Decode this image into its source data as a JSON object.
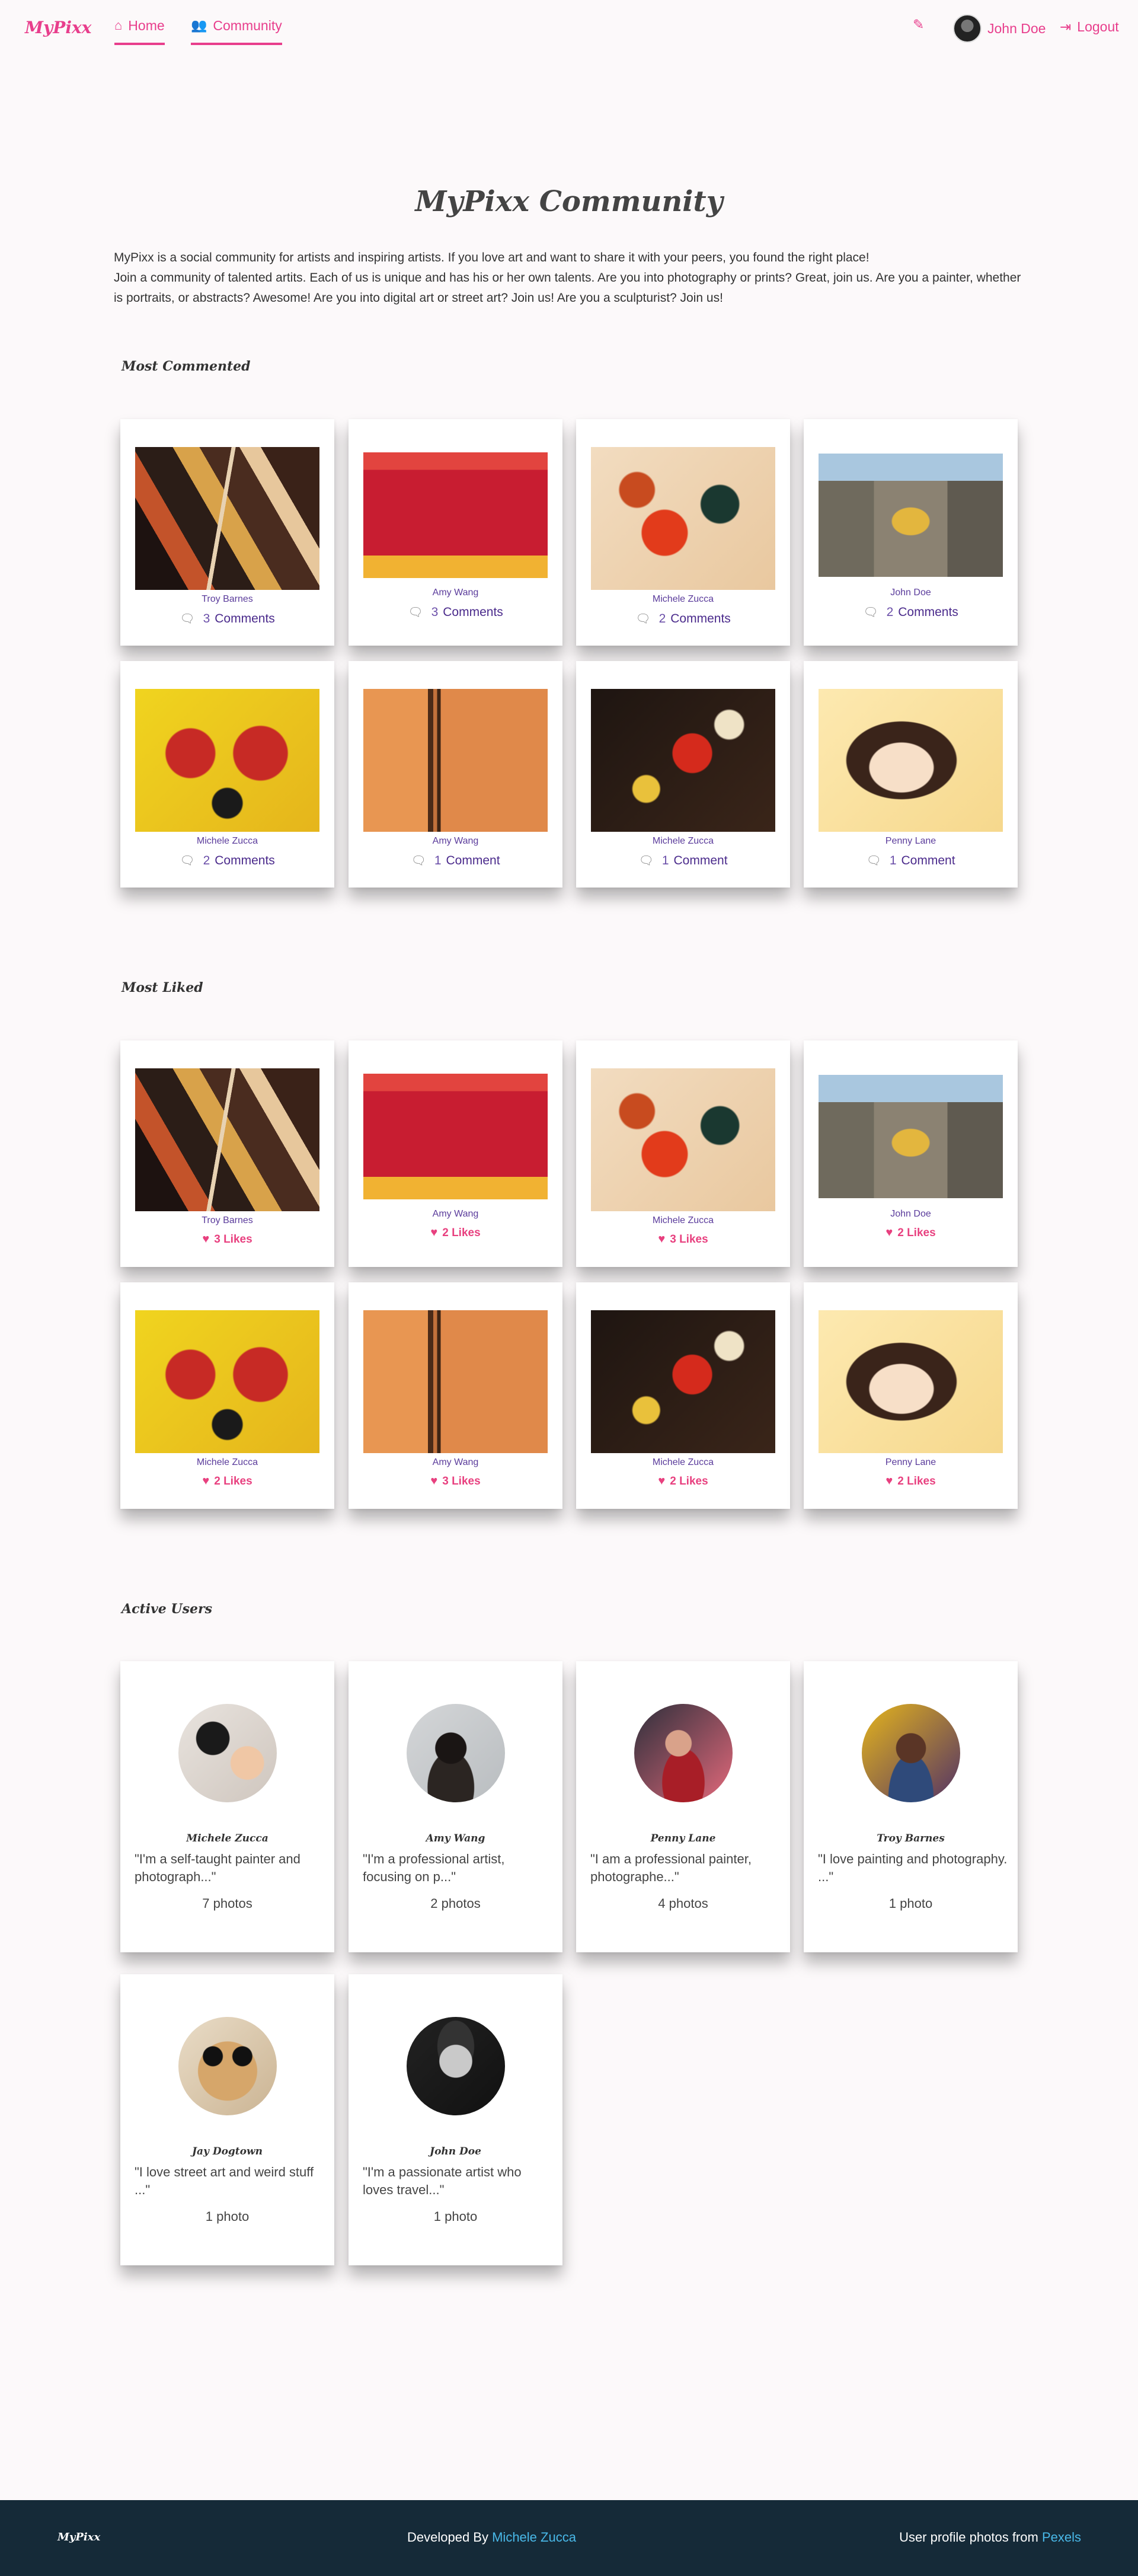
{
  "nav": {
    "brand": "MyPixx",
    "home": "Home",
    "community": "Community",
    "user": "John Doe",
    "logout": "Logout",
    "icons": [
      "home-icon",
      "users-icon",
      "pencil-icon",
      "logout-icon"
    ]
  },
  "page": {
    "title": "MyPixx Community",
    "intro_1": "MyPixx is a social community for artists and inspiring artists. If you love art and want to share it with your peers, you found the right place!",
    "intro_2": "Join a community of talented artits. Each of us is unique and has his or her own talents. Are you into photography or prints? Great, join us. Are you a painter, whether is portraits, or abstracts? Awesome! Are you into digital art or street art? Join us! Are you a sculpturist? Join us!"
  },
  "sections": {
    "most_commented": "Most Commented",
    "most_liked": "Most Liked",
    "active_users": "Active Users"
  },
  "most_commented": [
    {
      "artist": "Troy Barnes",
      "count": "3",
      "label": "Comments"
    },
    {
      "artist": "Amy Wang",
      "count": "3",
      "label": "Comments"
    },
    {
      "artist": "Michele Zucca",
      "count": "2",
      "label": "Comments"
    },
    {
      "artist": "John Doe",
      "count": "2",
      "label": "Comments"
    },
    {
      "artist": "Michele Zucca",
      "count": "2",
      "label": "Comments"
    },
    {
      "artist": "Amy Wang",
      "count": "1",
      "label": "Comment"
    },
    {
      "artist": "Michele Zucca",
      "count": "1",
      "label": "Comment"
    },
    {
      "artist": "Penny Lane",
      "count": "1",
      "label": "Comment"
    }
  ],
  "most_liked": [
    {
      "artist": "Troy Barnes",
      "likes": "3 Likes"
    },
    {
      "artist": "Amy Wang",
      "likes": "2 Likes"
    },
    {
      "artist": "Michele Zucca",
      "likes": "3 Likes"
    },
    {
      "artist": "John Doe",
      "likes": "2 Likes"
    },
    {
      "artist": "Michele Zucca",
      "likes": "2 Likes"
    },
    {
      "artist": "Amy Wang",
      "likes": "3 Likes"
    },
    {
      "artist": "Michele Zucca",
      "likes": "2 Likes"
    },
    {
      "artist": "Penny Lane",
      "likes": "2 Likes"
    }
  ],
  "active_users": [
    {
      "name": "Michele Zucca",
      "quote": "\"I'm a self-taught painter and photograph...\"",
      "photos": "7 photos"
    },
    {
      "name": "Amy Wang",
      "quote": "\"I'm a professional artist, focusing on p...\"",
      "photos": "2 photos"
    },
    {
      "name": "Penny Lane",
      "quote": "\"I am a professional painter, photographe...\"",
      "photos": "4 photos"
    },
    {
      "name": "Troy Barnes",
      "quote": "\"I love painting and photography. ...\"",
      "photos": "1 photo"
    },
    {
      "name": "Jay Dogtown",
      "quote": "\"I love street art and weird stuff ...\"",
      "photos": "1 photo"
    },
    {
      "name": "John Doe",
      "quote": "\"I'm a passionate artist who loves travel...\"",
      "photos": "1 photo"
    }
  ],
  "footer": {
    "brand": "MyPixx",
    "developed_prefix": "Developed By",
    "developer": "Michele Zucca",
    "photos_prefix": "User profile photos from",
    "photos_source": "Pexels"
  },
  "colors": {
    "accent": "#e83e8c",
    "footer_bg": "#152a38",
    "link": "#49b8e8"
  }
}
